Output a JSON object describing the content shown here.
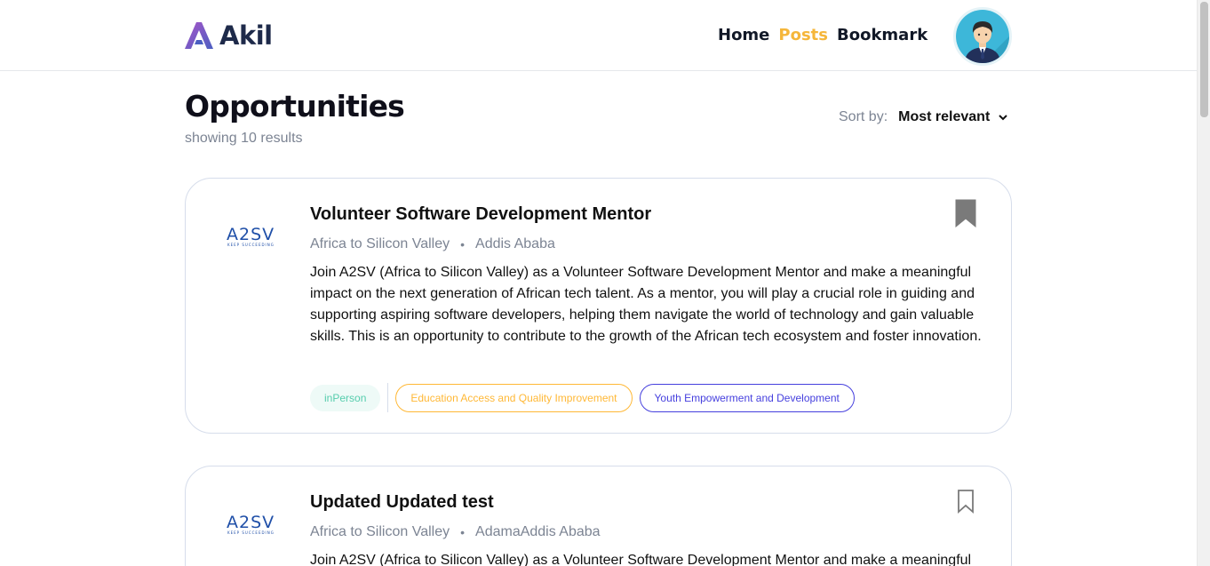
{
  "brand": {
    "name": "Akil"
  },
  "nav": [
    {
      "label": "Home",
      "active": false
    },
    {
      "label": "Posts",
      "active": true
    },
    {
      "label": "Bookmark",
      "active": false
    }
  ],
  "page": {
    "title": "Opportunities",
    "results_text": "showing 10 results"
  },
  "sort": {
    "label": "Sort by:",
    "value": "Most relevant"
  },
  "colors": {
    "accent": "#f5b63a",
    "tag_green": "#56cdad",
    "tag_orange": "#ffb836",
    "tag_blue": "#4640de"
  },
  "cards": [
    {
      "title": "Volunteer Software Development Mentor",
      "company": "Africa to Silicon Valley",
      "location": "Addis Ababa",
      "logo_text": "A2SV",
      "logo_tagline": "KEEP SUCCEEDING",
      "bookmarked": true,
      "description": "Join A2SV (Africa to Silicon Valley) as a Volunteer Software Development Mentor and make a meaningful impact on the next generation of African tech talent. As a mentor, you will play a crucial role in guiding and supporting aspiring software developers, helping them navigate the world of technology and gain valuable skills. This is an opportunity to contribute to the growth of the African tech ecosystem and foster innovation.",
      "tags": [
        "inPerson",
        "Education Access and Quality Improvement",
        "Youth Empowerment and Development"
      ]
    },
    {
      "title": "Updated Updated test",
      "company": "Africa to Silicon Valley",
      "location": "AdamaAddis Ababa",
      "logo_text": "A2SV",
      "logo_tagline": "KEEP SUCCEEDING",
      "bookmarked": false,
      "description": "Join A2SV (Africa to Silicon Valley) as a Volunteer Software Development Mentor and make a meaningful"
    }
  ],
  "icons": {
    "bookmark_filled": "bookmark-filled-icon",
    "bookmark_outline": "bookmark-outline-icon",
    "chevron": "chevron-down-icon"
  }
}
